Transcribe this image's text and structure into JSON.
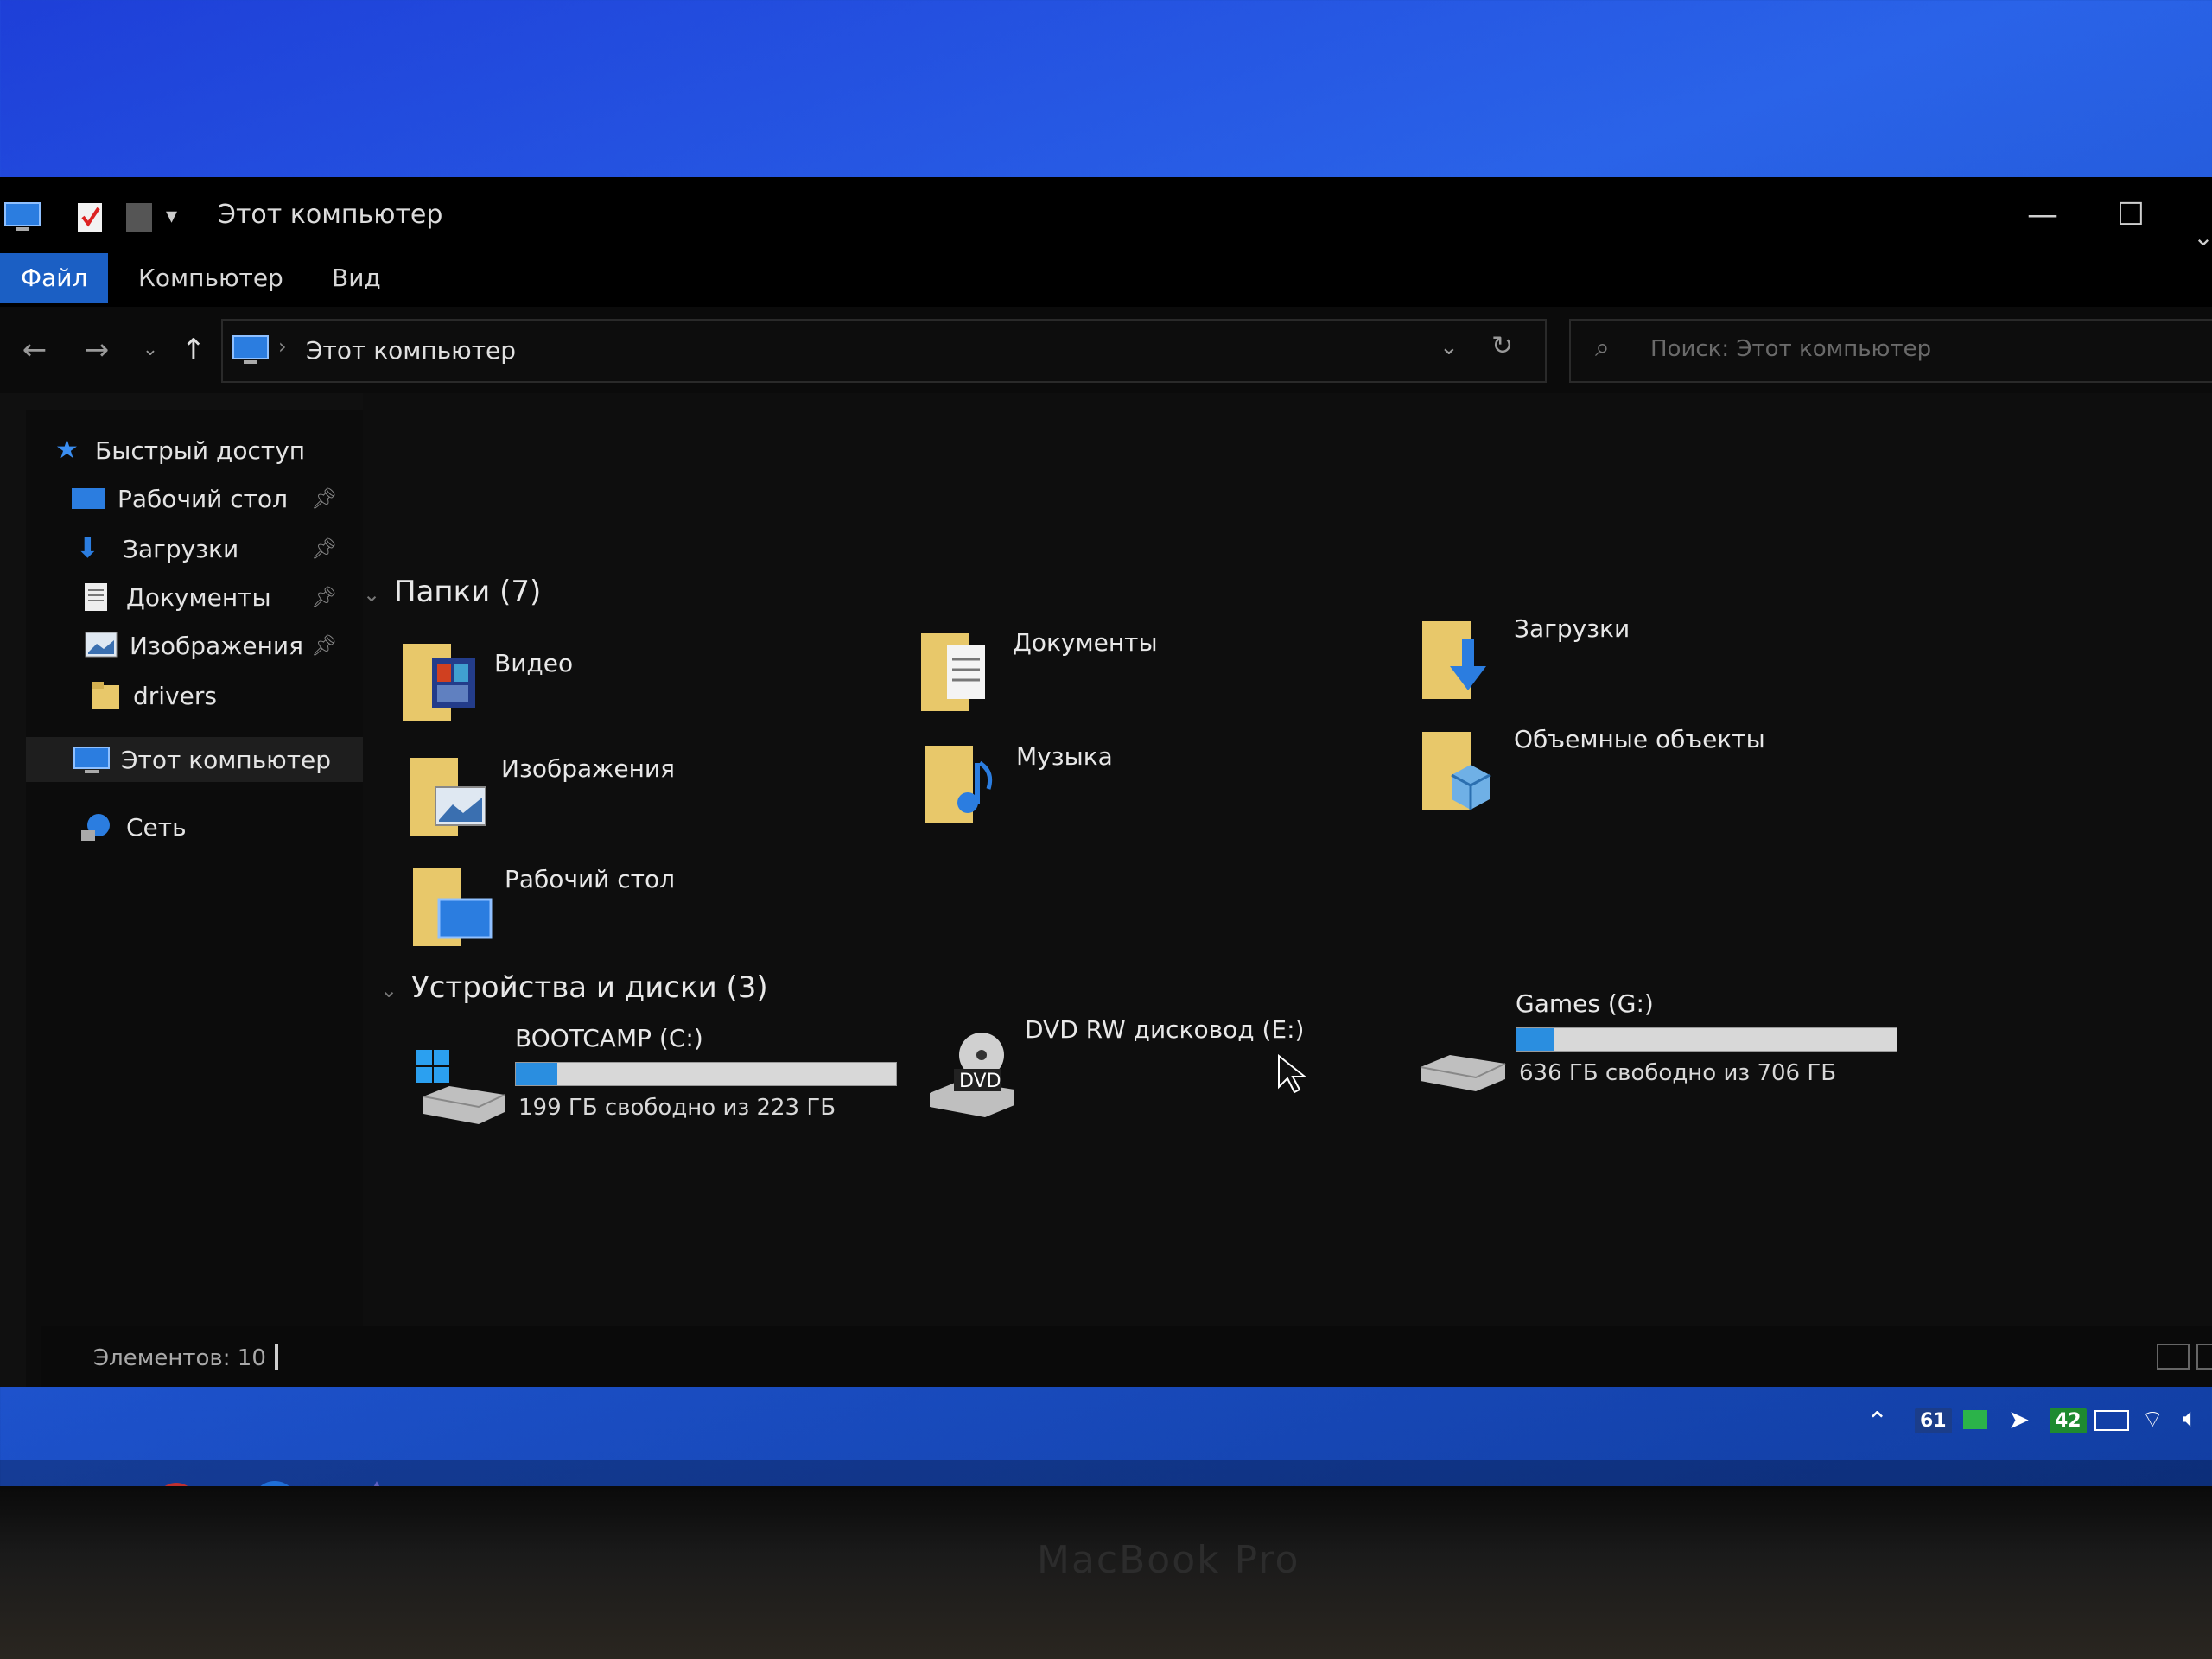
{
  "window": {
    "title": "Этот компьютер",
    "controls": {
      "minimize": "—",
      "maximize": "☐"
    }
  },
  "ribbon": {
    "tabs": [
      {
        "label": "Файл",
        "active": true
      },
      {
        "label": "Компьютер",
        "active": false
      },
      {
        "label": "Вид",
        "active": false
      }
    ]
  },
  "nav": {
    "address": "Этот компьютер",
    "search_placeholder": "Поиск: Этот компьютер"
  },
  "sidebar": {
    "items": [
      {
        "label": "Быстрый доступ",
        "icon": "star-icon",
        "pinned": false
      },
      {
        "label": "Рабочий стол",
        "icon": "desktop-icon",
        "pinned": true
      },
      {
        "label": "Загрузки",
        "icon": "download-arrow-icon",
        "pinned": true
      },
      {
        "label": "Документы",
        "icon": "document-icon",
        "pinned": true
      },
      {
        "label": "Изображения",
        "icon": "image-icon",
        "pinned": true
      },
      {
        "label": "drivers",
        "icon": "folder-icon",
        "pinned": false
      },
      {
        "label": "Этот компьютер",
        "icon": "computer-icon",
        "pinned": false,
        "selected": true
      },
      {
        "label": "Сеть",
        "icon": "network-icon",
        "pinned": false
      }
    ]
  },
  "folders": {
    "heading": "Папки (7)",
    "items": [
      {
        "label": "Видео",
        "icon": "video-folder-icon"
      },
      {
        "label": "Документы",
        "icon": "documents-folder-icon"
      },
      {
        "label": "Загрузки",
        "icon": "downloads-folder-icon"
      },
      {
        "label": "Изображения",
        "icon": "pictures-folder-icon"
      },
      {
        "label": "Музыка",
        "icon": "music-folder-icon"
      },
      {
        "label": "Объемные объекты",
        "icon": "3d-objects-folder-icon"
      },
      {
        "label": "Рабочий стол",
        "icon": "desktop-folder-icon"
      }
    ]
  },
  "drives": {
    "heading": "Устройства и диски (3)",
    "items": [
      {
        "name": "BOOTCAMP (C:)",
        "free_text": "199 ГБ свободно из 223 ГБ",
        "used_fraction": 0.11,
        "icon": "windows-drive-icon"
      },
      {
        "name": "DVD RW дисковод (E:)",
        "icon": "dvd-drive-icon",
        "icon_text": "DVD"
      },
      {
        "name": "Games (G:)",
        "free_text": "636 ГБ свободно из 706 ГБ",
        "used_fraction": 0.1,
        "icon": "hard-drive-icon"
      }
    ]
  },
  "status": {
    "items_count": "Элементов: 10"
  },
  "tray": {
    "badge1": "61",
    "badge2": "42"
  },
  "laptop": {
    "label": "MacBook Pro"
  },
  "colors": {
    "accent": "#1b5fc4",
    "bar_fill": "#2a8ee0",
    "folder": "#e8c86a"
  }
}
